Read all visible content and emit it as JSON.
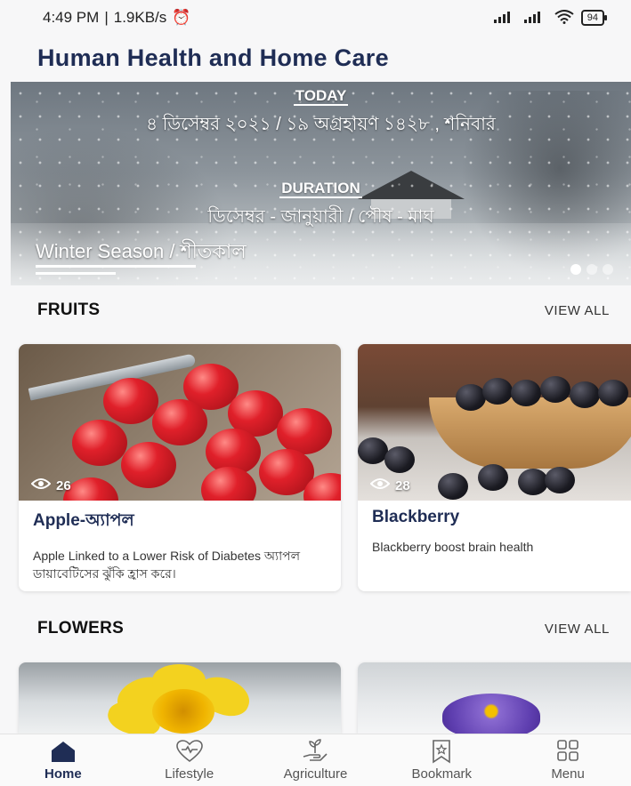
{
  "status_bar": {
    "time": "4:49 PM",
    "network_speed": "1.9KB/s",
    "battery": "94"
  },
  "app": {
    "title": "Human Health and Home Care"
  },
  "hero": {
    "today_label": "TODAY",
    "date_text": "৪ ডিসেম্বর ২০২১ / ১৯ অগ্রহায়ণ ১৪২৮ , শনিবার",
    "duration_label": "DURATION",
    "duration_text": "ডিসেম্বর - জানুয়ারী / পৌষ - মাঘ",
    "season_text": "Winter Season / শীতকাল"
  },
  "fruits": {
    "title": "FRUITS",
    "view_all": "VIEW ALL",
    "items": [
      {
        "views": "26",
        "title": "Apple-অ্যাপল",
        "description": "Apple Linked to a Lower Risk of Diabetes অ্যাপল ডায়াবেটিসের ঝুঁকি হ্রাস করে।"
      },
      {
        "views": "28",
        "title": "Blackberry",
        "description": "Blackberry boost brain health"
      }
    ]
  },
  "flowers": {
    "title": "FLOWERS",
    "view_all": "VIEW ALL"
  },
  "bottom_nav": {
    "items": [
      {
        "label": "Home",
        "icon": "home-icon"
      },
      {
        "label": "Lifestyle",
        "icon": "heart-pulse-icon"
      },
      {
        "label": "Agriculture",
        "icon": "plant-hand-icon"
      },
      {
        "label": "Bookmark",
        "icon": "bookmark-icon"
      },
      {
        "label": "Menu",
        "icon": "grid-icon"
      }
    ]
  },
  "colors": {
    "brand": "#1f2d55",
    "background": "#f7f7f8"
  }
}
